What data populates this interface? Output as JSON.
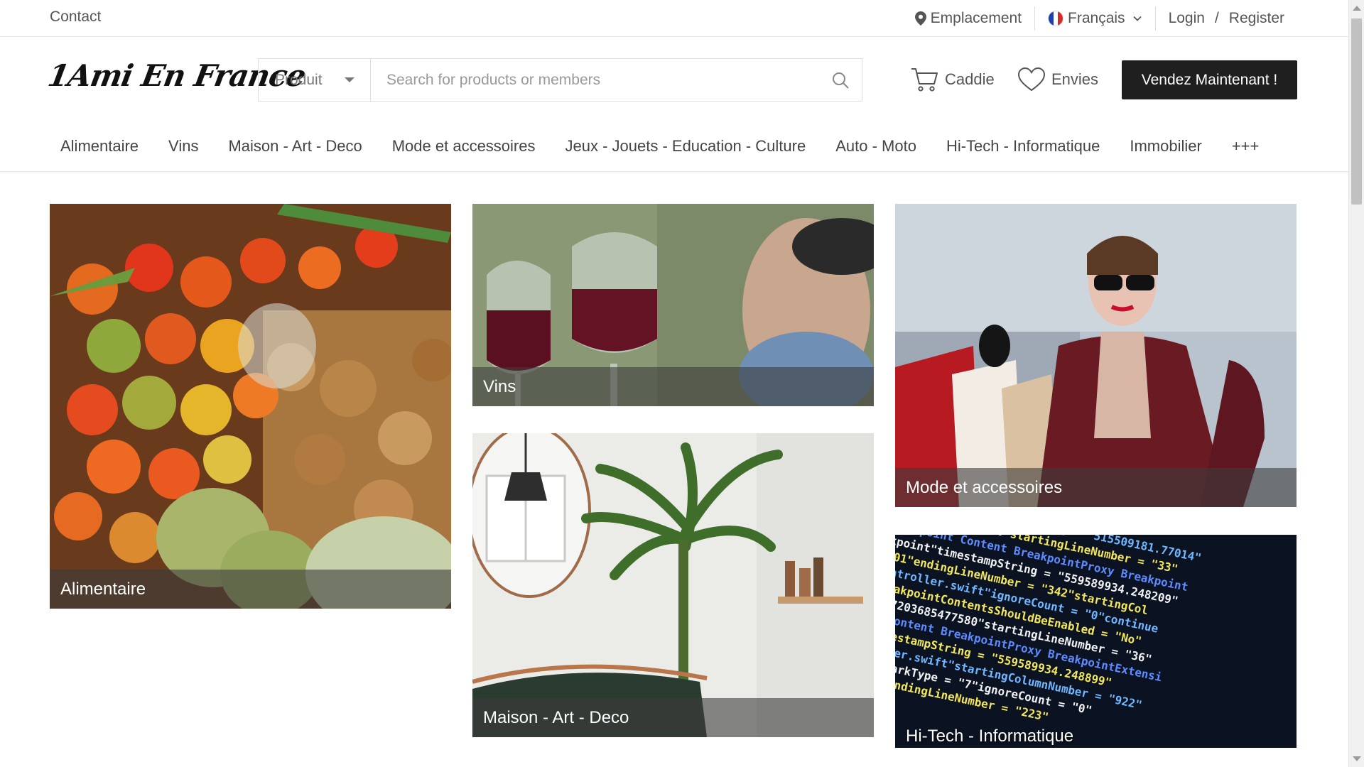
{
  "topbar": {
    "contact": "Contact",
    "location": "Emplacement",
    "language": "Français",
    "login": "Login",
    "slash": "/",
    "register": "Register"
  },
  "header": {
    "logo": "1Ami En France",
    "search_category": "Produit",
    "search_placeholder": "Search for products or members",
    "cart_label": "Caddie",
    "wishlist_label": "Envies",
    "sell_button": "Vendez Maintenant !"
  },
  "nav": {
    "items": [
      "Alimentaire",
      "Vins",
      "Maison - Art - Deco",
      "Mode et accessoires",
      "Jeux - Jouets - Education - Culture",
      "Auto - Moto",
      "Hi-Tech - Informatique",
      "Immobilier",
      "+++"
    ]
  },
  "tiles": {
    "food": "Alimentaire",
    "wine": "Vins",
    "home": "Maison - Art - Deco",
    "fashion": "Mode et accessoires",
    "tech": "Hi-Tech - Informatique"
  },
  "colors": {
    "button_bg": "#1f1f1f",
    "caption_overlay": "rgba(60,60,60,0.6)",
    "flag_blue": "#1f3fa8",
    "flag_red": "#d62a2a"
  },
  "icons": {
    "location": "map-pin-icon",
    "language": "french-flag-icon",
    "dropdown": "chevron-down-icon",
    "search": "search-icon",
    "cart": "cart-icon",
    "wishlist": "heart-icon"
  }
}
